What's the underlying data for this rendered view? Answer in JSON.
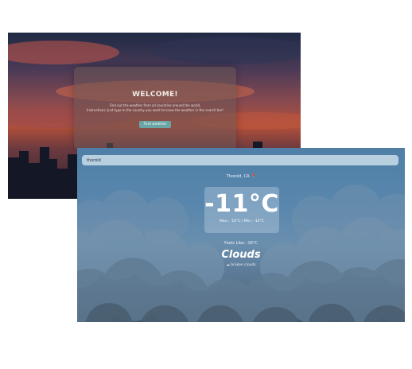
{
  "welcome_screen": {
    "title": "WELCOME!",
    "subtitle_line1": "Find out the weather from all countries around the world.",
    "subtitle_line2": "Instructions: Just type in the country you want to know the weather in the search bar!",
    "button_label": "Find weather"
  },
  "weather_screen": {
    "search_value": "thorold",
    "location": "Thorold, CA",
    "location_icon": "location-pin-icon",
    "temperature": "-11°C",
    "range": "Max.: -10°C / Min.: -14°C",
    "feels_like": "Feels Like: -16°C",
    "condition": "Clouds",
    "condition_icon": "cloud-icon",
    "condition_detail": "broken clouds"
  },
  "colors": {
    "button": "#6aa6a5",
    "weather_bg_top": "#4f7fa7",
    "sunset_orange": "#b3503a"
  }
}
